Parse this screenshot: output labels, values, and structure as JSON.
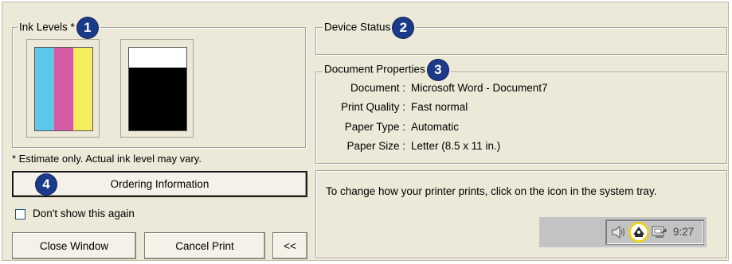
{
  "ink_levels": {
    "legend": "Ink Levels *",
    "badge": "1",
    "color_cartridge": {
      "cyan": 1.0,
      "magenta": 1.0,
      "yellow": 1.0,
      "colors": {
        "cyan": "#5ac8e9",
        "magenta": "#d55aa6",
        "yellow": "#f5ed5d"
      }
    },
    "black_cartridge": {
      "level": 0.76,
      "color": "#000000"
    },
    "note": "* Estimate only.  Actual ink level may vary."
  },
  "ordering_button": {
    "label": "Ordering Information",
    "badge": "4"
  },
  "dont_show": {
    "label": "Don't show this again",
    "checked": false
  },
  "buttons": {
    "close": "Close Window",
    "cancel": "Cancel Print",
    "collapse": "<<"
  },
  "device_status": {
    "legend": "Device Status",
    "badge": "2"
  },
  "document_properties": {
    "legend": "Document Properties",
    "badge": "3",
    "rows": [
      {
        "label": "Document :",
        "value": "Microsoft Word - Document7"
      },
      {
        "label": "Print Quality :",
        "value": "Fast normal"
      },
      {
        "label": "Paper Type :",
        "value": "Automatic"
      },
      {
        "label": "Paper Size :",
        "value": "Letter (8.5 x 11 in.)"
      }
    ]
  },
  "tray_info": {
    "text": "To change how your printer prints, click on the icon in the system tray.",
    "clock": "9:27",
    "icons": [
      "speaker-icon",
      "printer-tray-icon",
      "network-icon"
    ]
  }
}
